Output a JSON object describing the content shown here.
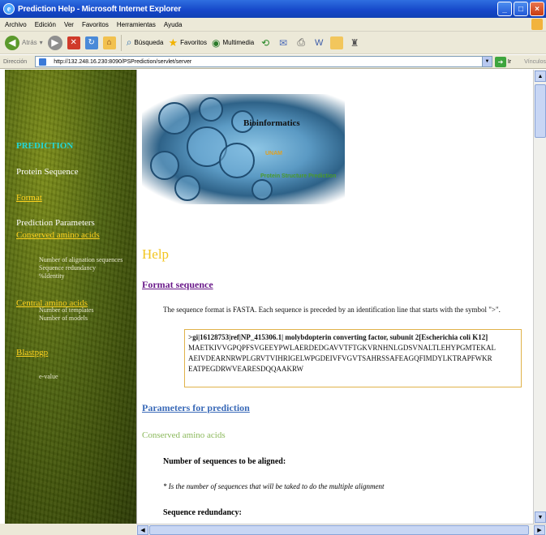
{
  "window": {
    "title": "Prediction Help - Microsoft Internet Explorer",
    "controls": [
      "_",
      "□",
      "×"
    ]
  },
  "menu": [
    "Archivo",
    "Edición",
    "Ver",
    "Favoritos",
    "Herramientas",
    "Ayuda"
  ],
  "toolbar": {
    "back_label": "Atrás",
    "search_label": "Búsqueda",
    "favorites_label": "Favoritos",
    "media_label": "Multimedia"
  },
  "address": {
    "label": "Dirección",
    "value": "http://132.248.16.230:8090/PSPrediction/servlet/server",
    "go_label": "Ir",
    "links_label": "Vínculos"
  },
  "sidebar": {
    "prediction": "PREDICTION",
    "protein_sequence": "Protein Sequence",
    "format": "Format",
    "prediction_parameters": "Prediction Parameters",
    "conserved": "Conserved amino acids",
    "conserved_sub": [
      "Number of alignation sequences",
      "Sequence redundancy",
      "%Identity"
    ],
    "central": "Central amino acids",
    "central_sub": [
      "Number of templates",
      "Number of models"
    ],
    "blast": "Blastpgp",
    "blast_sub": [
      "e-value"
    ]
  },
  "banner": {
    "title": "Bioinformatics",
    "unam": "UNAM",
    "subtitle": "Protein Structure Prediction"
  },
  "help": {
    "title": "Help",
    "format_heading": "Format sequence",
    "fasta_text": "The sequence format is FASTA. Each sequence is preceded by an identification line that starts with the symbol \">\".",
    "seq_header": ">gi|16128753|ref|NP_415306.1| molybdopterin converting factor, subunit 2[Escherichia coli K12]",
    "seq_lines": [
      "MAETKIVVGPQPFSVGEEYPWLAERDEDGAVVTFTGKVRNHNLGDSVNALTLEHYPGMTEKAL",
      "AEIVDEARNRWPLGRVTVIHRIGELWPGDEIVFVGVTSAHRSSAFEAGQFIMDYLKTRAPFWKR",
      "EATPEGDRWVEARESDQQAAKRW"
    ],
    "params_heading": "Parameters for prediction",
    "conserved_heading": "Conserved amino acids",
    "numseq_heading": "Number of sequences to be aligned:",
    "numseq_text": "* Is the number of sequences that will be taked to do the multiple alignment",
    "redundancy_heading": "Sequence redundancy:"
  }
}
